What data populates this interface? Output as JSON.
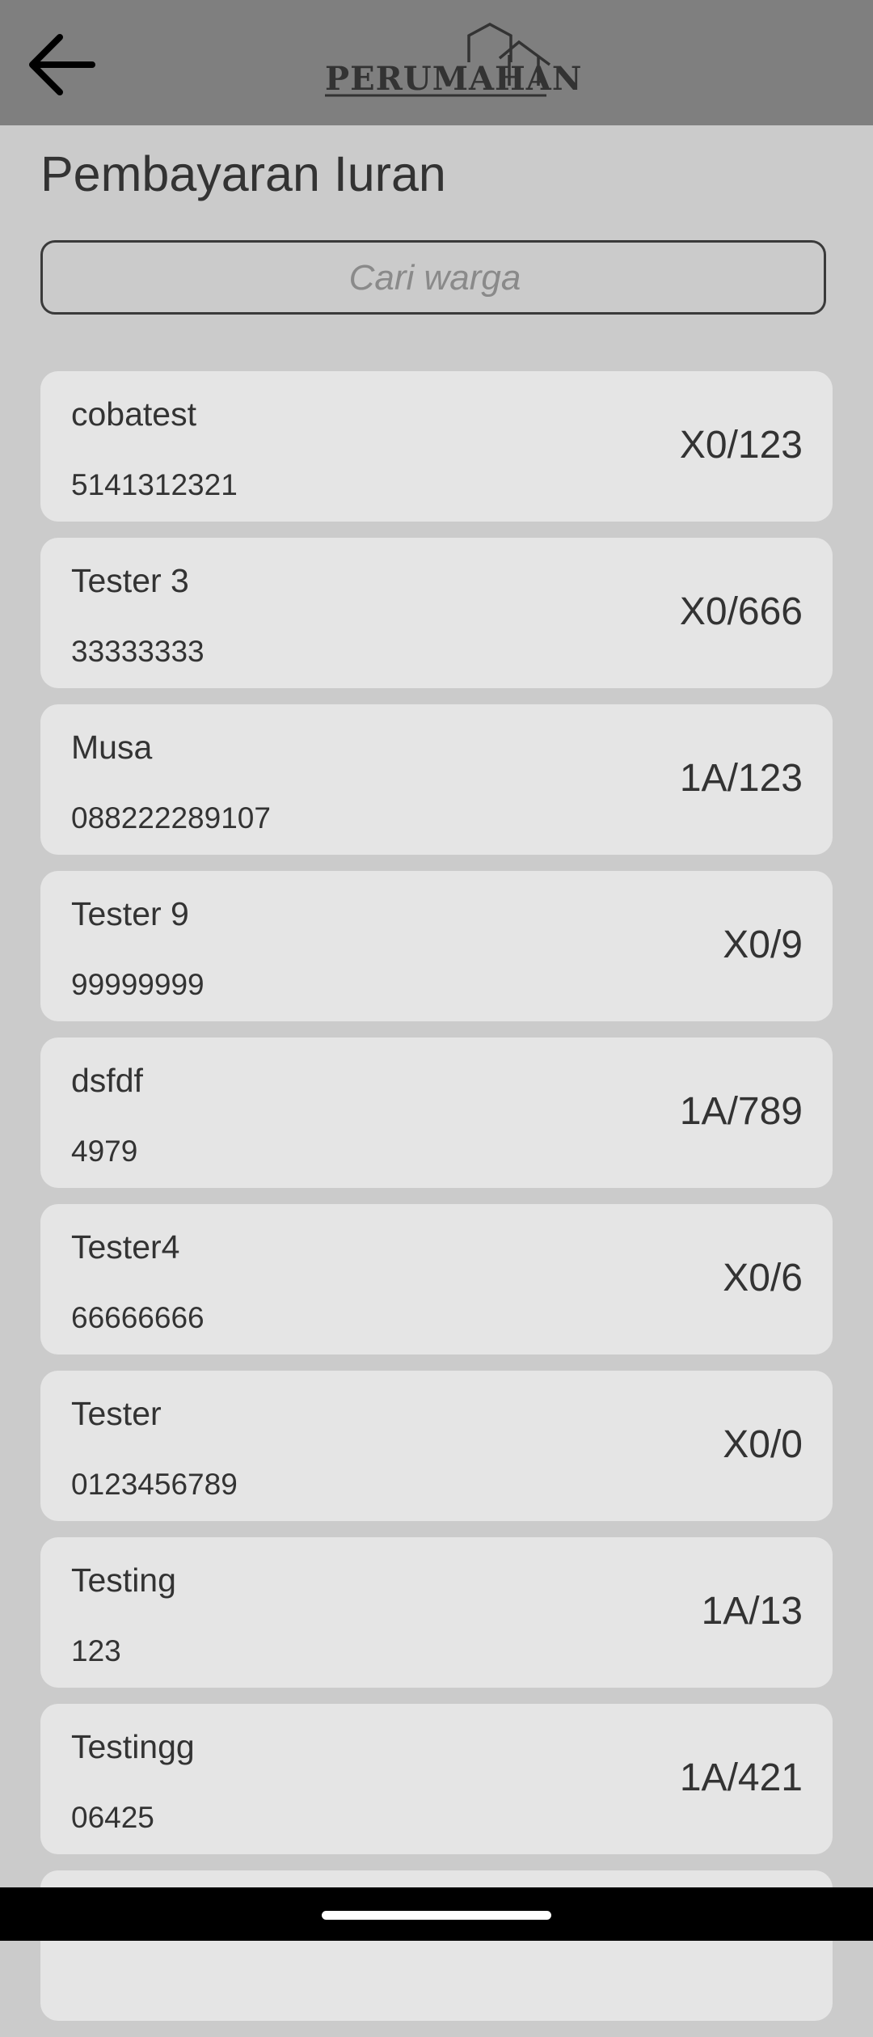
{
  "header": {
    "logo_text": "PERUMAHAN",
    "back_icon": "arrow-left-icon"
  },
  "page": {
    "title": "Pembayaran Iuran"
  },
  "search": {
    "placeholder": "Cari warga",
    "value": ""
  },
  "residents": [
    {
      "name": "cobatest",
      "phone": "5141312321",
      "unit": "X0/123"
    },
    {
      "name": "Tester 3",
      "phone": "33333333",
      "unit": "X0/666"
    },
    {
      "name": "Musa",
      "phone": "088222289107",
      "unit": "1A/123"
    },
    {
      "name": "Tester 9",
      "phone": "99999999",
      "unit": "X0/9"
    },
    {
      "name": "dsfdf",
      "phone": "4979",
      "unit": "1A/789"
    },
    {
      "name": "Tester4",
      "phone": "66666666",
      "unit": "X0/6"
    },
    {
      "name": "Tester",
      "phone": "0123456789",
      "unit": "X0/0"
    },
    {
      "name": "Testing",
      "phone": "123",
      "unit": "1A/13"
    },
    {
      "name": "Testingg",
      "phone": "06425",
      "unit": "1A/421"
    },
    {
      "name": "",
      "phone": "",
      "unit": ""
    }
  ],
  "colors": {
    "appbar": "#7f7f7f",
    "background": "#cbcbcb",
    "card": "#e5e5e5",
    "text": "#333333"
  }
}
